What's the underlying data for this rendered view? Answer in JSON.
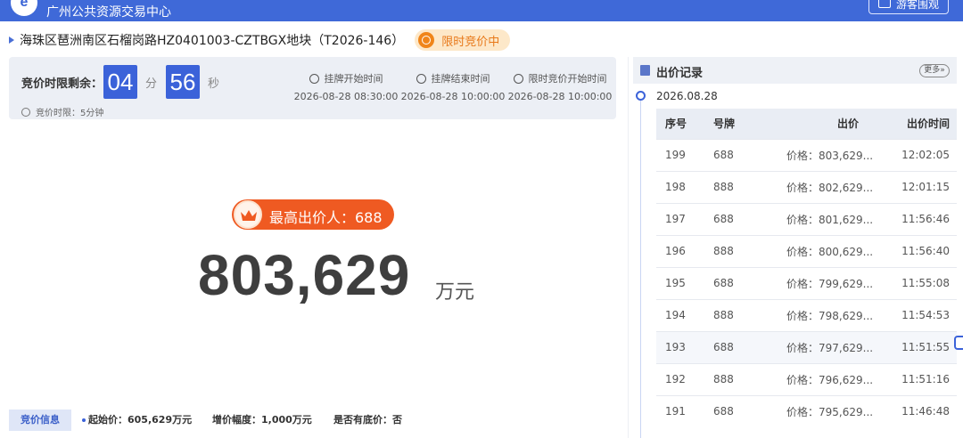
{
  "header": {
    "site_title": "广州公共资源交易中心",
    "guest_button": "游客围观"
  },
  "listing": {
    "title": "海珠区琶洲南区石榴岗路HZ0401003-CZTBGX地块（T2026-146）",
    "status": "限时竞价中"
  },
  "countdown": {
    "label": "竞价时限剩余：",
    "minutes": "04",
    "minutes_unit": "分",
    "seconds": "56",
    "seconds_unit": "秒",
    "limit_note": "竞价时限：5分钟",
    "times": [
      {
        "label": "挂牌开始时间",
        "value": "2026-08-28 08:30:00"
      },
      {
        "label": "挂牌结束时间",
        "value": "2026-08-28 10:00:00"
      },
      {
        "label": "限时竞价开始时间",
        "value": "2026-08-28 10:00:00"
      }
    ]
  },
  "leader": {
    "label": "最高出价人：688",
    "price": "803,629",
    "unit": "万元"
  },
  "info": {
    "tab": "竞价信息",
    "start_price": "起始价：605,629万元",
    "increment": "增价幅度：1,000万元",
    "reserve": "是否有底价：否"
  },
  "bids": {
    "title": "出价记录",
    "more": "更多",
    "date": "2026.08.28",
    "columns": [
      "序号",
      "号牌",
      "出价",
      "出价时间"
    ],
    "rows": [
      {
        "seq": "199",
        "plate": "688",
        "price": "价格：803,629...",
        "time": "12:02:05"
      },
      {
        "seq": "198",
        "plate": "888",
        "price": "价格：802,629...",
        "time": "12:01:15"
      },
      {
        "seq": "197",
        "plate": "688",
        "price": "价格：801,629...",
        "time": "11:56:46"
      },
      {
        "seq": "196",
        "plate": "888",
        "price": "价格：800,629...",
        "time": "11:56:40"
      },
      {
        "seq": "195",
        "plate": "688",
        "price": "价格：799,629...",
        "time": "11:55:08"
      },
      {
        "seq": "194",
        "plate": "888",
        "price": "价格：798,629...",
        "time": "11:54:53"
      },
      {
        "seq": "193",
        "plate": "688",
        "price": "价格：797,629...",
        "time": "11:51:55"
      },
      {
        "seq": "192",
        "plate": "888",
        "price": "价格：796,629...",
        "time": "11:51:16"
      },
      {
        "seq": "191",
        "plate": "688",
        "price": "价格：795,629...",
        "time": "11:46:48"
      }
    ]
  }
}
